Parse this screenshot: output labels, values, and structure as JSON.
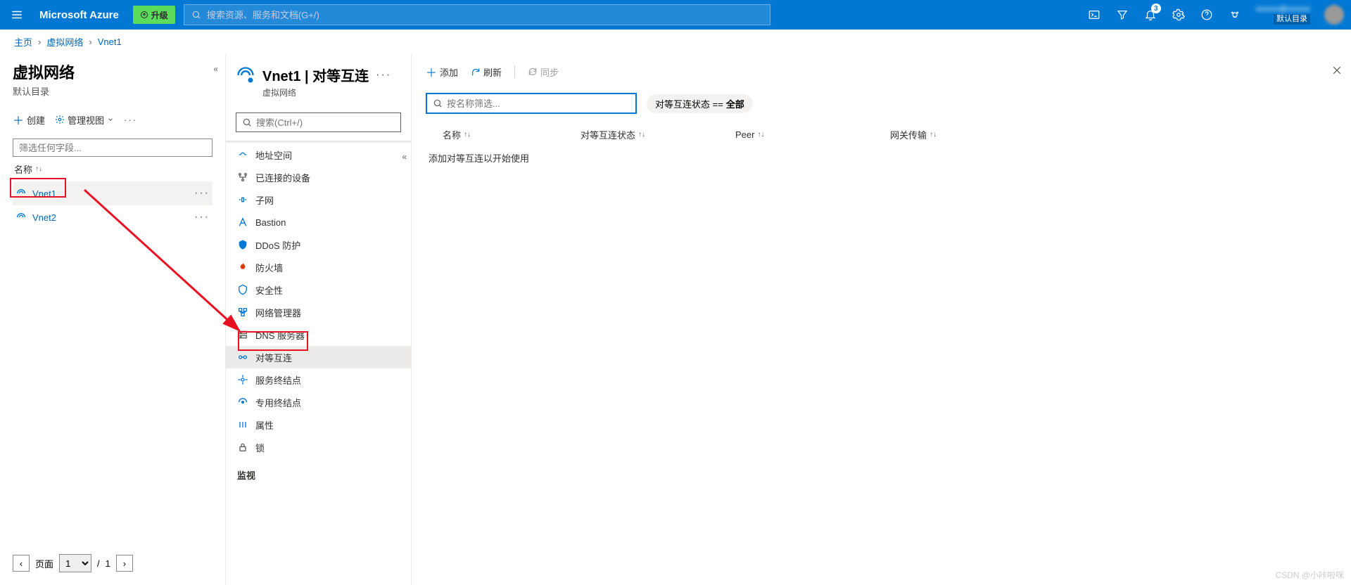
{
  "topbar": {
    "brand": "Microsoft Azure",
    "upgrade_label": "升级",
    "search_placeholder": "搜索资源、服务和文档(G+/)",
    "notification_count": "3",
    "user_email": "xxxxxx@xxxxxx",
    "user_directory": "默认目录"
  },
  "breadcrumb": {
    "items": [
      "主页",
      "虚拟网络",
      "Vnet1"
    ]
  },
  "list_panel": {
    "title": "虚拟网络",
    "subtitle": "默认目录",
    "toolbar": {
      "create": "创建",
      "manage_view": "管理视图"
    },
    "filter_placeholder": "筛选任何字段...",
    "column_name": "名称",
    "items": [
      {
        "name": "Vnet1"
      },
      {
        "name": "Vnet2"
      }
    ],
    "pager": {
      "page_label": "页面",
      "page": "1",
      "total": "1"
    }
  },
  "resource_header": {
    "title": "Vnet1 | 对等互连",
    "subtype": "虚拟网络"
  },
  "nav_search_placeholder": "搜索(Ctrl+/)",
  "nav_items": [
    {
      "icon": "address-space-icon",
      "label": "地址空间"
    },
    {
      "icon": "connected-devices-icon",
      "label": "已连接的设备"
    },
    {
      "icon": "subnet-icon",
      "label": "子网"
    },
    {
      "icon": "bastion-icon",
      "label": "Bastion"
    },
    {
      "icon": "ddos-icon",
      "label": "DDoS 防护"
    },
    {
      "icon": "firewall-icon",
      "label": "防火墙"
    },
    {
      "icon": "security-icon",
      "label": "安全性"
    },
    {
      "icon": "network-manager-icon",
      "label": "网络管理器"
    },
    {
      "icon": "dns-icon",
      "label": "DNS 服务器"
    },
    {
      "icon": "peering-icon",
      "label": "对等互连",
      "selected": true
    },
    {
      "icon": "service-endpoint-icon",
      "label": "服务终结点"
    },
    {
      "icon": "private-endpoint-icon",
      "label": "专用终结点"
    },
    {
      "icon": "properties-icon",
      "label": "属性"
    },
    {
      "icon": "lock-icon",
      "label": "锁"
    }
  ],
  "nav_section_monitor": "监视",
  "main_toolbar": {
    "add": "添加",
    "refresh": "刷新",
    "sync": "同步"
  },
  "main_filter": {
    "name_placeholder": "按名称筛选...",
    "status_pill_prefix": "对等互连状态 == ",
    "status_pill_value": "全部"
  },
  "table": {
    "columns": {
      "name": "名称",
      "status": "对等互连状态",
      "peer": "Peer",
      "gateway": "网关传输"
    },
    "empty_message": "添加对等互连以开始使用"
  },
  "watermark": "CSDN @小咔啦咪"
}
